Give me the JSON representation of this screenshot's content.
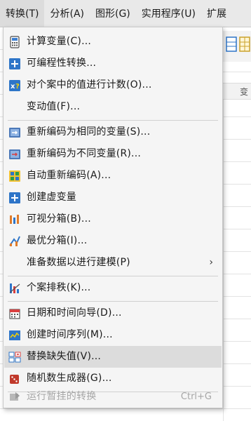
{
  "menubar": {
    "items": [
      {
        "label": "转换(T)"
      },
      {
        "label": "分析(A)"
      },
      {
        "label": "图形(G)"
      },
      {
        "label": "实用程序(U)"
      },
      {
        "label": "扩展"
      }
    ]
  },
  "background": {
    "column_header": "变"
  },
  "menu": {
    "items": [
      {
        "label": "计算变量(C)...",
        "icon": "calculator-icon"
      },
      {
        "label": "可编程性转换...",
        "icon": "plus-icon"
      },
      {
        "label": "对个案中的值进行计数(O)...",
        "icon": "count-icon"
      },
      {
        "label": "变动值(F)...",
        "icon": ""
      },
      {
        "label": "重新编码为相同的变量(S)...",
        "icon": "recode-same-icon"
      },
      {
        "label": "重新编码为不同变量(R)...",
        "icon": "recode-different-icon"
      },
      {
        "label": "自动重新编码(A)...",
        "icon": "auto-recode-icon"
      },
      {
        "label": "创建虚变量",
        "icon": "plus-icon"
      },
      {
        "label": "可视分箱(B)...",
        "icon": "visual-binning-icon"
      },
      {
        "label": "最优分箱(I)...",
        "icon": "optimal-binning-icon"
      },
      {
        "label": "准备数据以进行建模(P)",
        "icon": "",
        "submenu_arrow": "›"
      },
      {
        "label": "个案排秩(K)...",
        "icon": "rank-cases-icon"
      },
      {
        "label": "日期和时间向导(D)...",
        "icon": "calendar-icon"
      },
      {
        "label": "创建时间序列(M)...",
        "icon": "time-series-icon"
      },
      {
        "label": "替换缺失值(V)...",
        "icon": "replace-missing-icon"
      },
      {
        "label": "随机数生成器(G)...",
        "icon": "dice-icon"
      },
      {
        "label": "运行暂挂的转换",
        "icon": "run-pending-icon",
        "shortcut": "Ctrl+G",
        "disabled": true
      }
    ]
  },
  "colors": {
    "menu_bg": "#f5f5f5",
    "highlight": "#dcdcdc",
    "disabled_text": "#a6a6a6",
    "icon_blue": "#2e75c8"
  }
}
